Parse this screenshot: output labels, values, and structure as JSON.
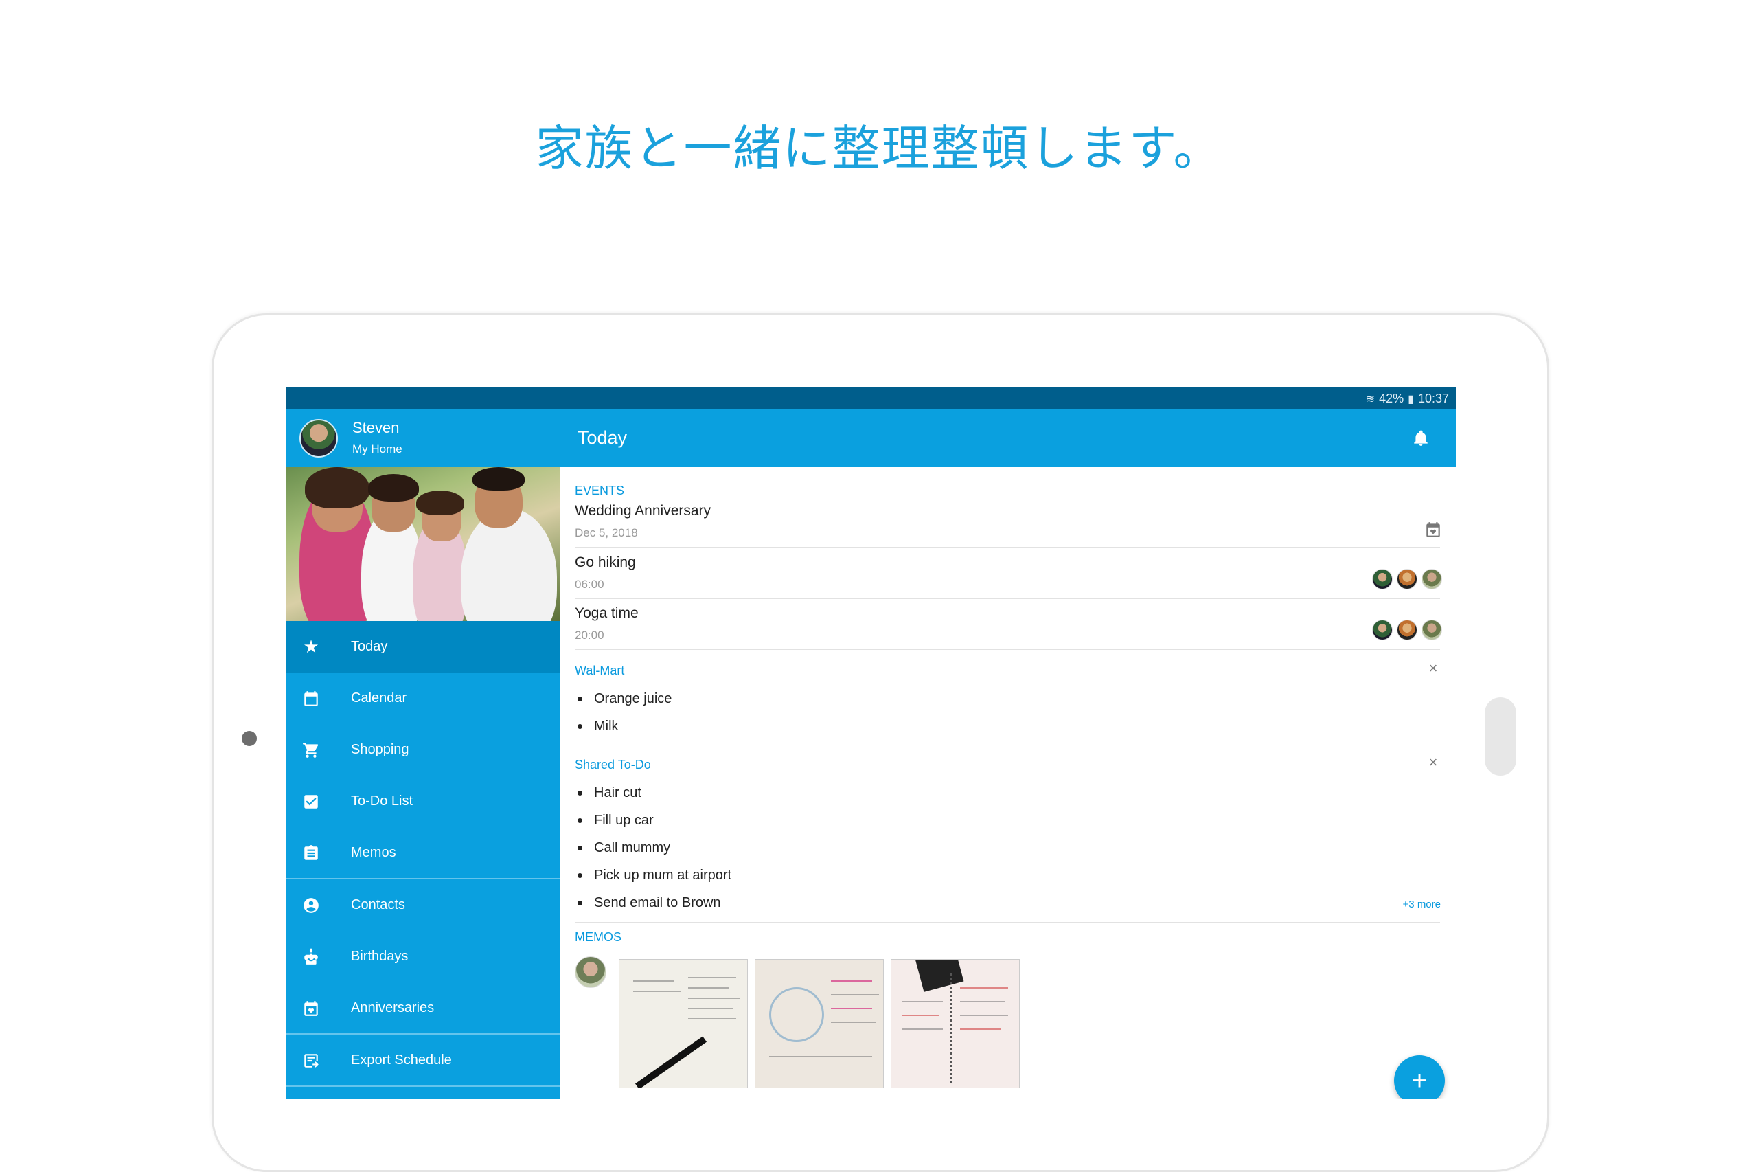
{
  "headline": "家族と一緒に整理整頓します。",
  "status_bar": {
    "battery": "42%",
    "time": "10:37"
  },
  "user": {
    "name": "Steven",
    "home": "My Home"
  },
  "toolbar": {
    "title": "Today"
  },
  "nav": [
    {
      "label": "Today",
      "icon": "star-icon"
    },
    {
      "label": "Calendar",
      "icon": "calendar-icon"
    },
    {
      "label": "Shopping",
      "icon": "cart-icon"
    },
    {
      "label": "To-Do List",
      "icon": "checkbox-icon"
    },
    {
      "label": "Memos",
      "icon": "clipboard-icon"
    },
    {
      "label": "Contacts",
      "icon": "contact-icon"
    },
    {
      "label": "Birthdays",
      "icon": "cake-icon"
    },
    {
      "label": "Anniversaries",
      "icon": "calendar-heart-icon"
    },
    {
      "label": "Export Schedule",
      "icon": "export-icon"
    }
  ],
  "events": {
    "label": "EVENTS",
    "items": [
      {
        "title": "Wedding Anniversary",
        "sub": "Dec 5, 2018"
      },
      {
        "title": "Go hiking",
        "sub": "06:00"
      },
      {
        "title": "Yoga time",
        "sub": "20:00"
      }
    ]
  },
  "walmart": {
    "label": "Wal-Mart",
    "items": [
      "Orange juice",
      "Milk"
    ]
  },
  "todo": {
    "label": "Shared To-Do",
    "items": [
      "Hair cut",
      "Fill up car",
      "Call mummy",
      "Pick up mum at airport",
      "Send email to Brown"
    ],
    "more": "+3 more"
  },
  "memos": {
    "label": "MEMOS"
  },
  "colors": {
    "accent": "#0aa0df",
    "status_bar": "#005e8c",
    "headline": "#1ba1dc"
  }
}
